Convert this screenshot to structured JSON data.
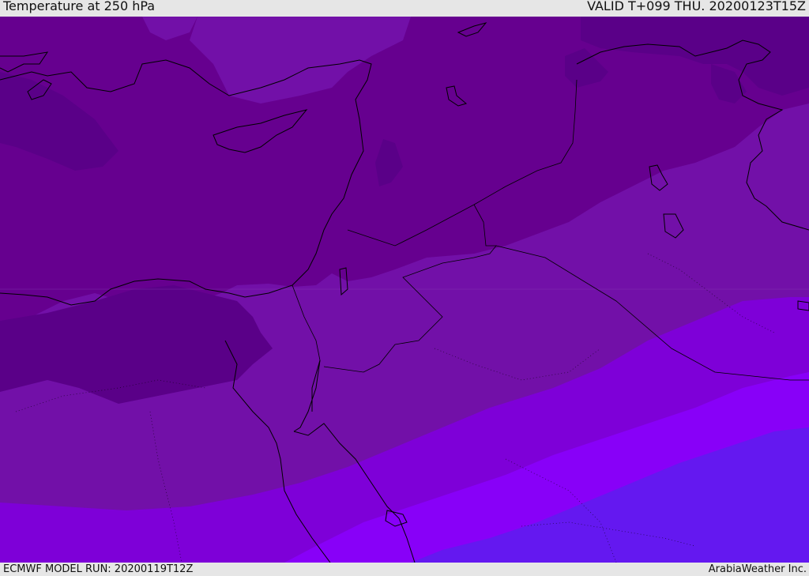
{
  "header": {
    "title": "Temperature at 250 hPa",
    "valid": "VALID T+099 THU. 20200123T15Z"
  },
  "footer": {
    "model_run": "ECMWF MODEL RUN: 20200119T12Z",
    "credit": "ArabiaWeather Inc."
  },
  "map": {
    "variable": "temperature",
    "level": "250 hPa",
    "colors": {
      "darkest": "#5a0088",
      "dark": "#66008f",
      "mid": "#7210a8",
      "bright": "#7e00d8",
      "brightest": "#8800f8",
      "blue_violet": "#6418f0",
      "coastline": "#000000"
    }
  }
}
